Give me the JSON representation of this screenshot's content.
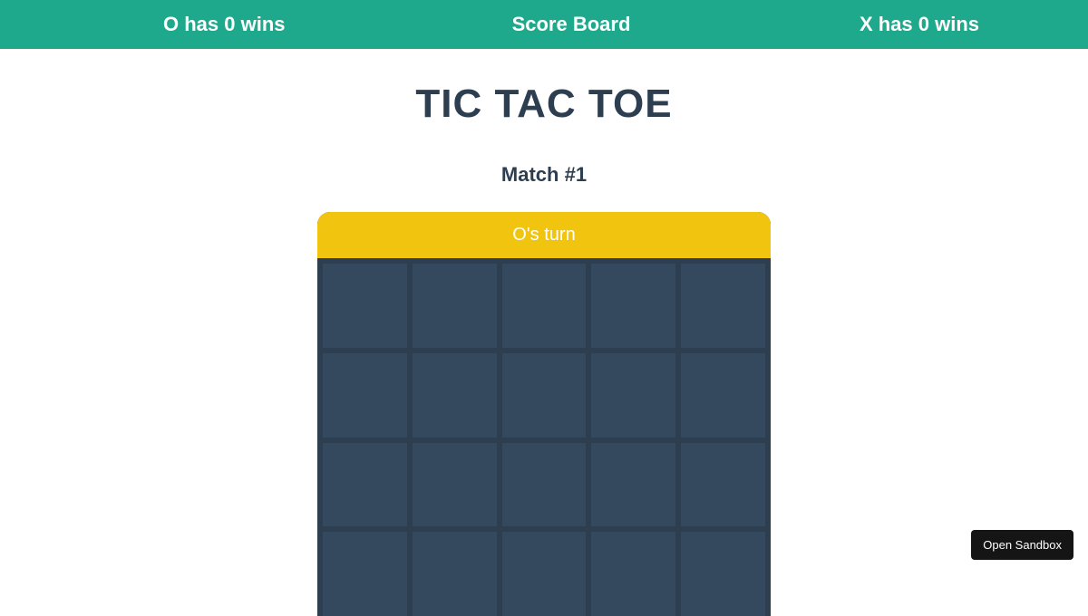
{
  "scoreboard": {
    "o_wins_text": "O has 0 wins",
    "title": "Score Board",
    "x_wins_text": "X has 0 wins"
  },
  "game": {
    "title": "TIC TAC TOE",
    "match_label": "Match #1",
    "turn_label": "O's turn"
  },
  "sandbox": {
    "button_label": "Open Sandbox"
  }
}
